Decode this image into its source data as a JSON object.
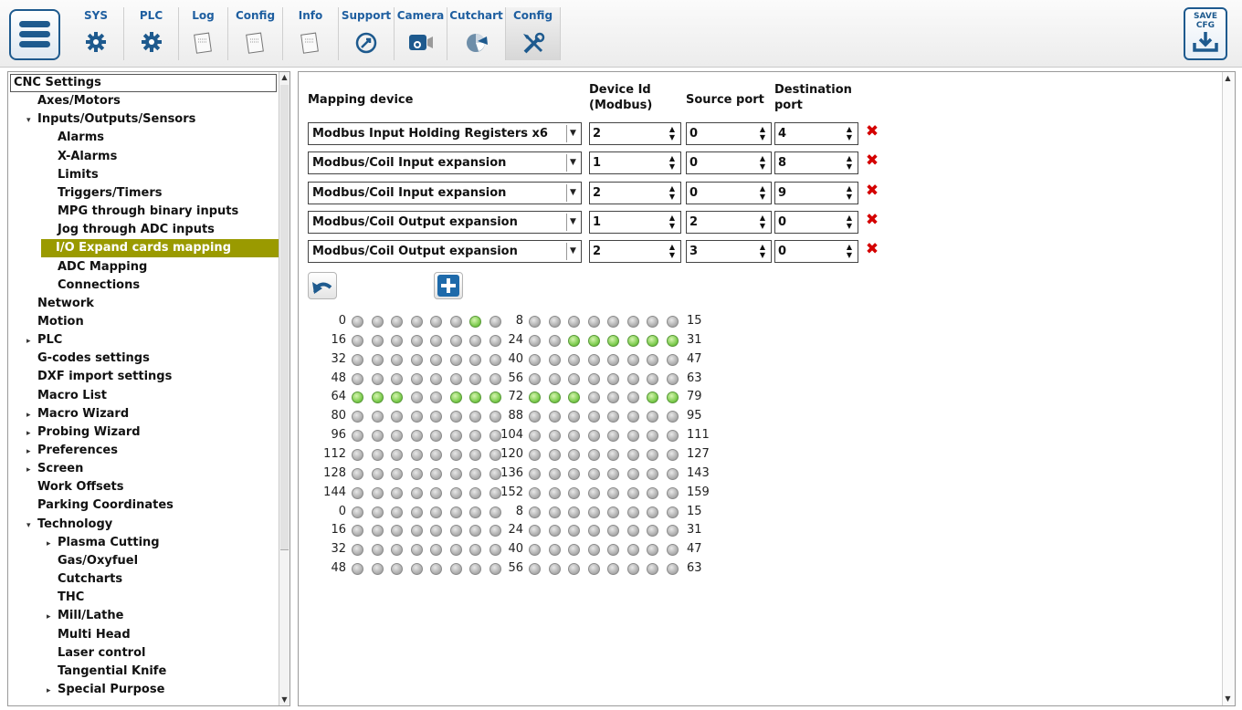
{
  "toolbar": {
    "tabs": [
      {
        "label": "SYS",
        "icon": "gear-icon"
      },
      {
        "label": "PLC",
        "icon": "gear-icon"
      },
      {
        "label": "Log",
        "icon": "log-sheet-icon"
      },
      {
        "label": "Config",
        "icon": "config-sheet-icon"
      },
      {
        "label": "Info",
        "icon": "info-sheet-icon"
      },
      {
        "label": "Support",
        "icon": "support-icon"
      },
      {
        "label": "Camera",
        "icon": "camera-icon"
      },
      {
        "label": "Cutchart",
        "icon": "pie-chart-icon"
      },
      {
        "label": "Config",
        "icon": "tools-icon"
      }
    ],
    "active_tab": 8,
    "save_label": "SAVE\nCFG"
  },
  "sidebar": {
    "items": [
      {
        "label": "CNC Settings",
        "level": 0,
        "arrow": ""
      },
      {
        "label": "Axes/Motors",
        "level": 1,
        "arrow": ""
      },
      {
        "label": "Inputs/Outputs/Sensors",
        "level": 1,
        "arrow": "▾"
      },
      {
        "label": "Alarms",
        "level": 2,
        "arrow": ""
      },
      {
        "label": "X-Alarms",
        "level": 2,
        "arrow": ""
      },
      {
        "label": "Limits",
        "level": 2,
        "arrow": ""
      },
      {
        "label": "Triggers/Timers",
        "level": 2,
        "arrow": ""
      },
      {
        "label": "MPG through binary inputs",
        "level": 2,
        "arrow": ""
      },
      {
        "label": "Jog through ADC inputs",
        "level": 2,
        "arrow": ""
      },
      {
        "label": "I/O Expand cards mapping",
        "level": 2,
        "arrow": "",
        "selected": true
      },
      {
        "label": "ADC Mapping",
        "level": 2,
        "arrow": ""
      },
      {
        "label": "Connections",
        "level": 2,
        "arrow": ""
      },
      {
        "label": "Network",
        "level": 1,
        "arrow": ""
      },
      {
        "label": "Motion",
        "level": 1,
        "arrow": ""
      },
      {
        "label": "PLC",
        "level": 1,
        "arrow": "▸"
      },
      {
        "label": "G-codes settings",
        "level": 1,
        "arrow": ""
      },
      {
        "label": "DXF import settings",
        "level": 1,
        "arrow": ""
      },
      {
        "label": "Macro List",
        "level": 1,
        "arrow": ""
      },
      {
        "label": "Macro Wizard",
        "level": 1,
        "arrow": "▸"
      },
      {
        "label": "Probing Wizard",
        "level": 1,
        "arrow": "▸"
      },
      {
        "label": "Preferences",
        "level": 1,
        "arrow": "▸"
      },
      {
        "label": "Screen",
        "level": 1,
        "arrow": "▸"
      },
      {
        "label": "Work Offsets",
        "level": 1,
        "arrow": ""
      },
      {
        "label": "Parking Coordinates",
        "level": 1,
        "arrow": ""
      },
      {
        "label": "Technology",
        "level": 1,
        "arrow": "▾"
      },
      {
        "label": "Plasma Cutting",
        "level": 2,
        "arrow": "▸"
      },
      {
        "label": "Gas/Oxyfuel",
        "level": 2,
        "arrow": ""
      },
      {
        "label": "Cutcharts",
        "level": 2,
        "arrow": ""
      },
      {
        "label": "THC",
        "level": 2,
        "arrow": ""
      },
      {
        "label": "Mill/Lathe",
        "level": 2,
        "arrow": "▸"
      },
      {
        "label": "Multi Head",
        "level": 2,
        "arrow": ""
      },
      {
        "label": "Laser control",
        "level": 2,
        "arrow": ""
      },
      {
        "label": "Tangential Knife",
        "level": 2,
        "arrow": ""
      },
      {
        "label": "Special Purpose",
        "level": 2,
        "arrow": "▸"
      }
    ]
  },
  "mapping": {
    "headers": {
      "device": "Mapping device",
      "device_id": "Device Id\n(Modbus)",
      "source": "Source port",
      "destination": "Destination\nport"
    },
    "rows": [
      {
        "device": "Modbus Input Holding Registers x6",
        "device_id": "2",
        "source": "0",
        "destination": "4"
      },
      {
        "device": "Modbus/Coil Input expansion",
        "device_id": "1",
        "source": "0",
        "destination": "8"
      },
      {
        "device": "Modbus/Coil Input expansion",
        "device_id": "2",
        "source": "0",
        "destination": "9"
      },
      {
        "device": "Modbus/Coil Output expansion",
        "device_id": "1",
        "source": "2",
        "destination": "0"
      },
      {
        "device": "Modbus/Coil Output expansion",
        "device_id": "2",
        "source": "3",
        "destination": "0"
      }
    ],
    "delete_icon": "delete-x-icon",
    "undo_icon": "undo-icon",
    "add_icon": "plus-icon"
  },
  "io_grid": {
    "rows": [
      {
        "left": "0",
        "mid": "8",
        "right": "15",
        "a": [
          0,
          0,
          0,
          0,
          0,
          0,
          1,
          0
        ],
        "b": [
          0,
          0,
          0,
          0,
          0,
          0,
          0,
          0
        ]
      },
      {
        "left": "16",
        "mid": "24",
        "right": "31",
        "a": [
          0,
          0,
          0,
          0,
          0,
          0,
          0,
          0
        ],
        "b": [
          0,
          0,
          1,
          1,
          1,
          1,
          1,
          1
        ]
      },
      {
        "left": "32",
        "mid": "40",
        "right": "47",
        "a": [
          0,
          0,
          0,
          0,
          0,
          0,
          0,
          0
        ],
        "b": [
          0,
          0,
          0,
          0,
          0,
          0,
          0,
          0
        ]
      },
      {
        "left": "48",
        "mid": "56",
        "right": "63",
        "a": [
          0,
          0,
          0,
          0,
          0,
          0,
          0,
          0
        ],
        "b": [
          0,
          0,
          0,
          0,
          0,
          0,
          0,
          0
        ]
      },
      {
        "left": "64",
        "mid": "72",
        "right": "79",
        "a": [
          1,
          1,
          1,
          0,
          0,
          1,
          1,
          1
        ],
        "b": [
          1,
          1,
          1,
          0,
          0,
          0,
          1,
          1
        ]
      },
      {
        "left": "80",
        "mid": "88",
        "right": "95",
        "a": [
          0,
          0,
          0,
          0,
          0,
          0,
          0,
          0
        ],
        "b": [
          0,
          0,
          0,
          0,
          0,
          0,
          0,
          0
        ]
      },
      {
        "left": "96",
        "mid": "104",
        "right": "111",
        "a": [
          0,
          0,
          0,
          0,
          0,
          0,
          0,
          0
        ],
        "b": [
          0,
          0,
          0,
          0,
          0,
          0,
          0,
          0
        ]
      },
      {
        "left": "112",
        "mid": "120",
        "right": "127",
        "a": [
          0,
          0,
          0,
          0,
          0,
          0,
          0,
          0
        ],
        "b": [
          0,
          0,
          0,
          0,
          0,
          0,
          0,
          0
        ]
      },
      {
        "left": "128",
        "mid": "136",
        "right": "143",
        "a": [
          0,
          0,
          0,
          0,
          0,
          0,
          0,
          0
        ],
        "b": [
          0,
          0,
          0,
          0,
          0,
          0,
          0,
          0
        ]
      },
      {
        "left": "144",
        "mid": "152",
        "right": "159",
        "a": [
          0,
          0,
          0,
          0,
          0,
          0,
          0,
          0
        ],
        "b": [
          0,
          0,
          0,
          0,
          0,
          0,
          0,
          0
        ]
      },
      {
        "left": "0",
        "mid": "8",
        "right": "15",
        "a": [
          0,
          0,
          0,
          0,
          0,
          0,
          0,
          0
        ],
        "b": [
          0,
          0,
          0,
          0,
          0,
          0,
          0,
          0
        ]
      },
      {
        "left": "16",
        "mid": "24",
        "right": "31",
        "a": [
          0,
          0,
          0,
          0,
          0,
          0,
          0,
          0
        ],
        "b": [
          0,
          0,
          0,
          0,
          0,
          0,
          0,
          0
        ]
      },
      {
        "left": "32",
        "mid": "40",
        "right": "47",
        "a": [
          0,
          0,
          0,
          0,
          0,
          0,
          0,
          0
        ],
        "b": [
          0,
          0,
          0,
          0,
          0,
          0,
          0,
          0
        ]
      },
      {
        "left": "48",
        "mid": "56",
        "right": "63",
        "a": [
          0,
          0,
          0,
          0,
          0,
          0,
          0,
          0
        ],
        "b": [
          0,
          0,
          0,
          0,
          0,
          0,
          0,
          0
        ]
      }
    ]
  },
  "colors": {
    "accent": "#1e5a8e",
    "tab_label": "#1f5fa0",
    "selected_bg": "#9a9a00",
    "led_on": "#79c94a",
    "led_off": "#a8a8a8",
    "delete": "#d40000"
  }
}
